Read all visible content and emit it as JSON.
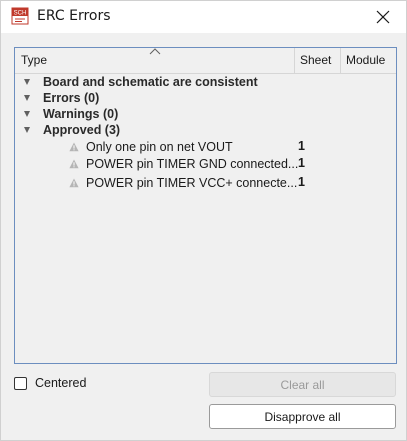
{
  "window": {
    "title": "ERC Errors",
    "app_icon_text": "SCH"
  },
  "tree": {
    "columns": [
      "Type",
      "Sheet",
      "Module"
    ],
    "groups": [
      {
        "label": "Board and schematic are consistent"
      },
      {
        "label": "Errors (0)"
      },
      {
        "label": "Warnings (0)"
      },
      {
        "label": "Approved (3)"
      }
    ],
    "items": [
      {
        "label": "Only one pin on net VOUT",
        "sheet": "1"
      },
      {
        "label": "POWER pin TIMER GND connected...",
        "sheet": "1"
      },
      {
        "label": "POWER pin TIMER VCC+ connecte...",
        "sheet": "1"
      }
    ]
  },
  "controls": {
    "centered_label": "Centered",
    "centered_checked": false,
    "clear_all_label": "Clear all",
    "clear_all_enabled": false,
    "disapprove_all_label": "Disapprove all"
  },
  "colors": {
    "accent_border": "#6c8ebf",
    "icon_red": "#c0392b",
    "warning_gray": "#8a8a8a"
  }
}
